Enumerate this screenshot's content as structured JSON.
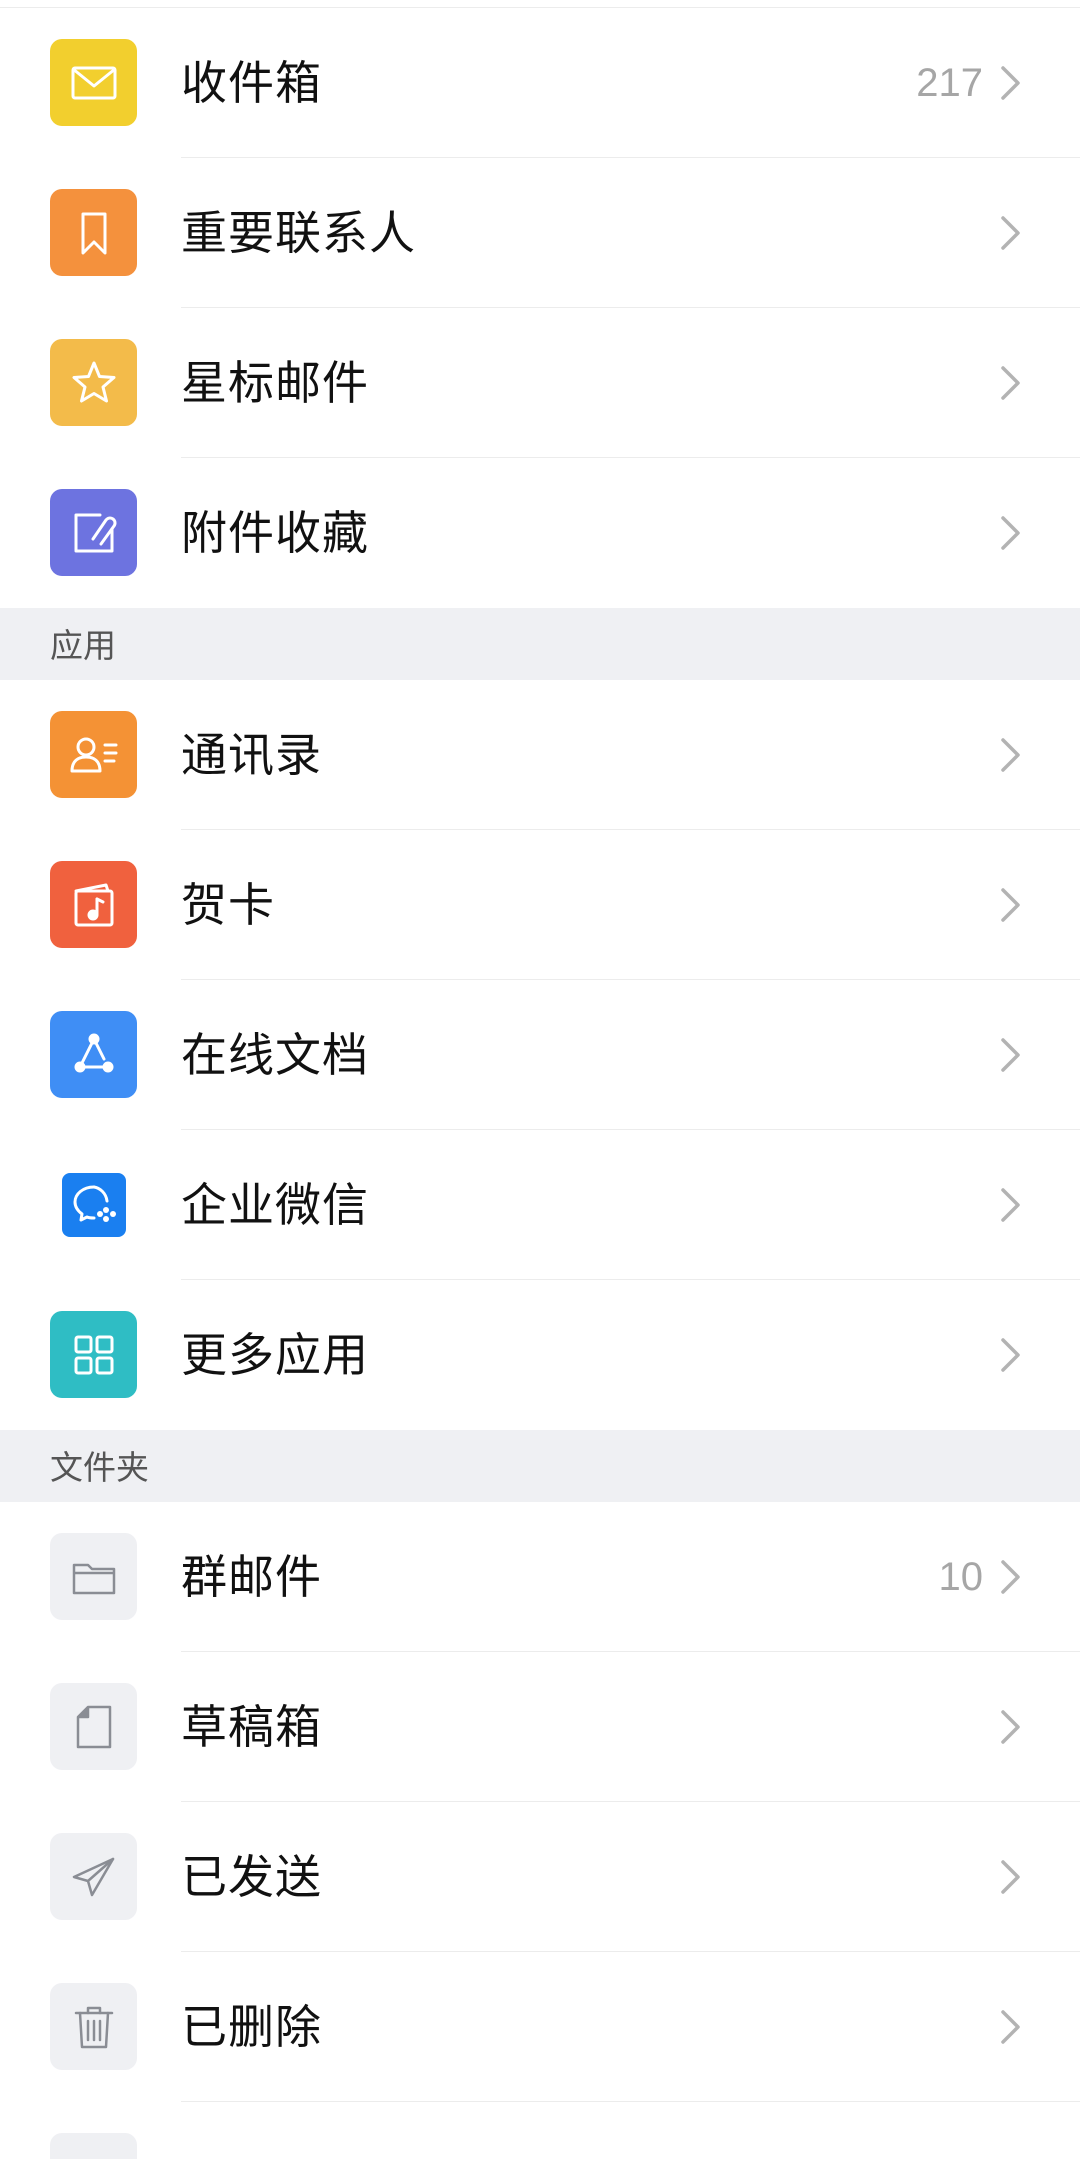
{
  "mailboxes": [
    {
      "label": "收件箱",
      "count": "217",
      "icon": "envelope-icon",
      "color": "#f2cf2e"
    },
    {
      "label": "重要联系人",
      "count": "",
      "icon": "bookmark-icon",
      "color": "#f4913d"
    },
    {
      "label": "星标邮件",
      "count": "",
      "icon": "star-icon",
      "color": "#f3bb4a"
    },
    {
      "label": "附件收藏",
      "count": "",
      "icon": "paperclip-icon",
      "color": "#6d73e0"
    }
  ],
  "apps_section": {
    "title": "应用",
    "items": [
      {
        "label": "通讯录",
        "count": "",
        "icon": "contacts-icon",
        "color": "#f49235"
      },
      {
        "label": "贺卡",
        "count": "",
        "icon": "greeting-card-icon",
        "color": "#f0613e"
      },
      {
        "label": "在线文档",
        "count": "",
        "icon": "online-doc-icon",
        "color": "#3f8ef5"
      },
      {
        "label": "企业微信",
        "count": "",
        "icon": "wecom-icon",
        "color": "#1a7ff0"
      },
      {
        "label": "更多应用",
        "count": "",
        "icon": "grid-icon",
        "color": "#2fbdc4"
      }
    ]
  },
  "folders_section": {
    "title": "文件夹",
    "items": [
      {
        "label": "群邮件",
        "count": "10",
        "icon": "folder-icon",
        "color": "#eff0f3"
      },
      {
        "label": "草稿箱",
        "count": "",
        "icon": "draft-icon",
        "color": "#eff0f3"
      },
      {
        "label": "已发送",
        "count": "",
        "icon": "send-icon",
        "color": "#eff0f3"
      },
      {
        "label": "已删除",
        "count": "",
        "icon": "trash-icon",
        "color": "#eff0f3"
      }
    ]
  }
}
